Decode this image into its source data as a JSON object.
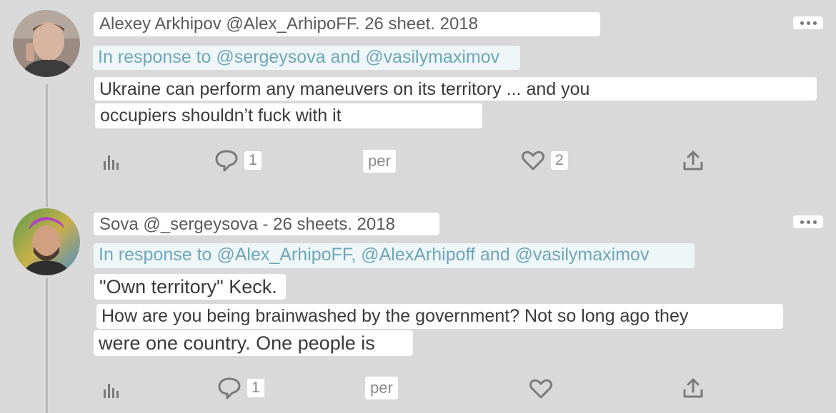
{
  "tweets": [
    {
      "meta": "Alexey Arkhipov @Alex_ArhipoFF. 26 sheet. 2018",
      "reply": "In response to @sergeysova and @vasilymaximov",
      "lines": [
        "Ukraine can perform any maneuvers on its territory ... and you",
        "occupiers shouldn’t fuck with it"
      ],
      "actions": {
        "reply_count": "1",
        "retweet_label": "per",
        "like_count": "2"
      }
    },
    {
      "meta": "Sova @_sergeysova - 26 sheets. 2018",
      "reply": "In response to @Alex_ArhipoFF, @AlexArhipoff and @vasilymaximov",
      "lines": [
        "\"Own territory\" Keck.",
        "How are you being brainwashed by the government? Not so long ago they",
        "were one country. One people is"
      ],
      "actions": {
        "reply_count": "1",
        "retweet_label": "per"
      }
    }
  ],
  "icons": {
    "analytics": "bar-chart-icon",
    "reply": "comment-bubble-icon",
    "like": "heart-icon",
    "share": "share-upload-icon",
    "more": "more-dots-icon"
  },
  "colors": {
    "background": "#d9d9d9",
    "link": "#6fa6b8",
    "icon": "#7a7a7a"
  }
}
